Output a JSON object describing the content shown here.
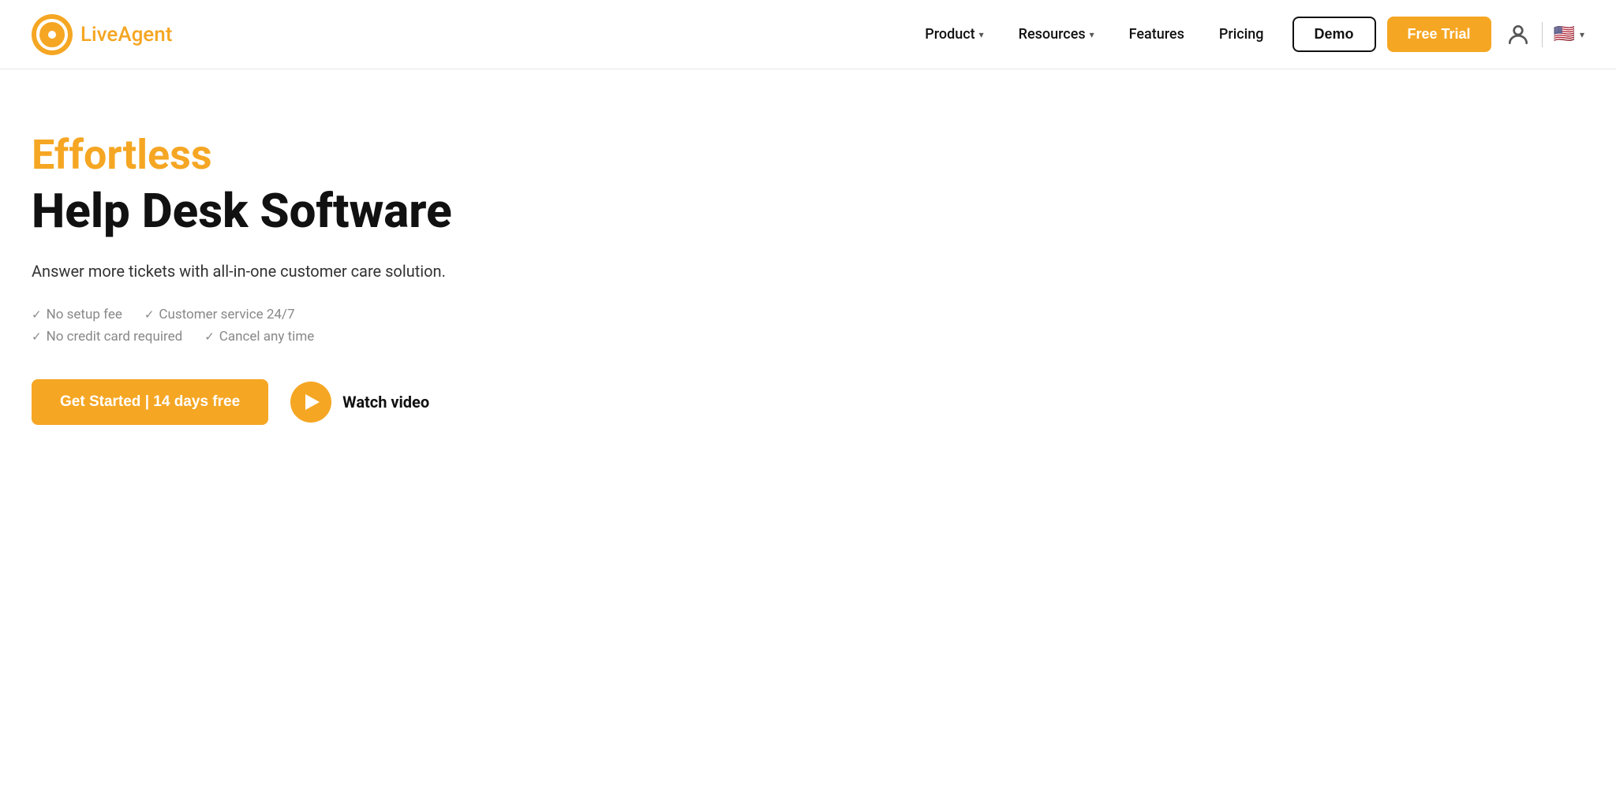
{
  "nav": {
    "logo_live": "Live",
    "logo_agent": "Agent",
    "product_label": "Product",
    "resources_label": "Resources",
    "features_label": "Features",
    "pricing_label": "Pricing",
    "demo_label": "Demo",
    "free_trial_label": "Free Trial",
    "lang_chevron": "▾"
  },
  "hero": {
    "eyebrow": "Effortless",
    "title": "Help Desk Software",
    "subtitle": "Answer more tickets with all-in-one customer care solution.",
    "check1a": "No setup fee",
    "check1b": "Customer service 24/7",
    "check2a": "No credit card required",
    "check2b": "Cancel any time",
    "get_started_label": "Get Started | 14 days free",
    "watch_video_label": "Watch video"
  },
  "colors": {
    "orange": "#F5A623",
    "dark": "#111111",
    "gray": "#888888"
  }
}
